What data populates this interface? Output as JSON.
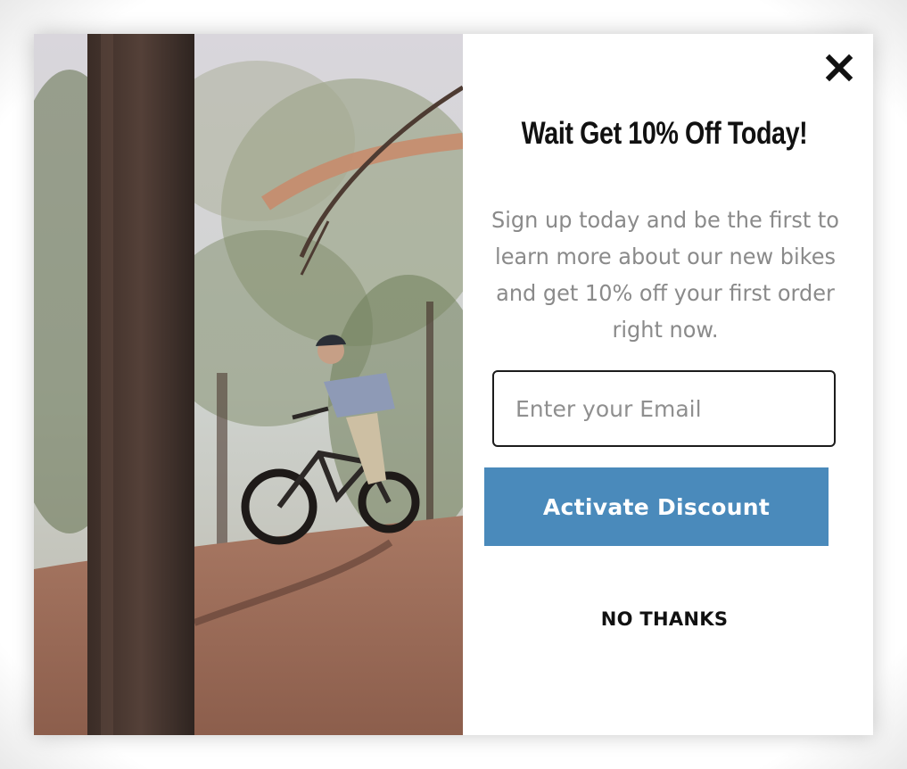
{
  "popup": {
    "headline": "Wait Get 10% Off Today!",
    "description": "Sign up today and be the first to learn more about our new bikes and get 10% off your first order right now.",
    "email_value": "",
    "email_placeholder": "Enter your Email",
    "cta_label": "Activate Discount",
    "decline_label": "NO THANKS",
    "close_icon": "close-icon",
    "hero_image": "mountain-biker-jumping-in-forest-photo"
  },
  "colors": {
    "cta_background": "#4a8abb",
    "headline": "#111111",
    "body_text": "#8a8a8a",
    "background": "#ffffff"
  }
}
